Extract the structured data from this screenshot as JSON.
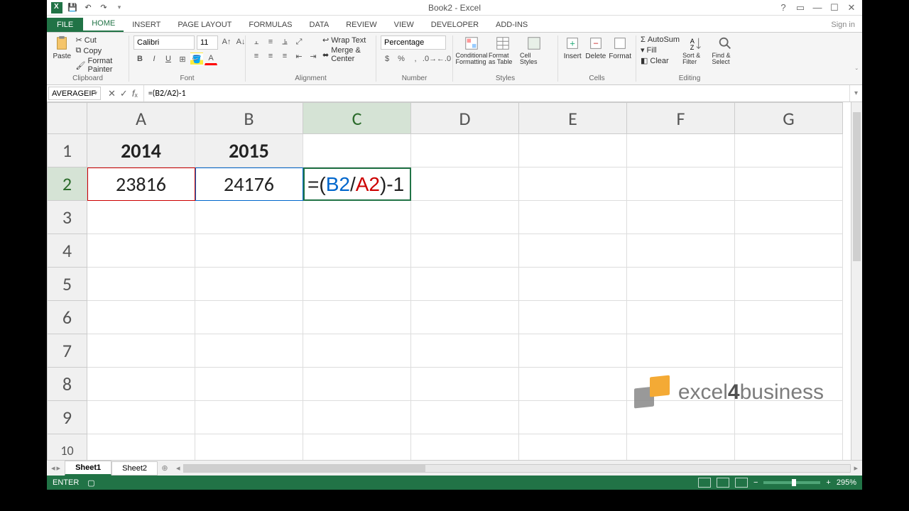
{
  "title": "Book2 - Excel",
  "tabs": {
    "file": "FILE",
    "list": [
      "HOME",
      "INSERT",
      "PAGE LAYOUT",
      "FORMULAS",
      "DATA",
      "REVIEW",
      "VIEW",
      "DEVELOPER",
      "ADD-INS"
    ],
    "active": "HOME",
    "signin": "Sign in"
  },
  "ribbon": {
    "clipboard": {
      "label": "Clipboard",
      "paste": "Paste",
      "cut": "Cut",
      "copy": "Copy",
      "painter": "Format Painter"
    },
    "font": {
      "label": "Font",
      "name": "Calibri",
      "size": "11"
    },
    "alignment": {
      "label": "Alignment",
      "wrap": "Wrap Text",
      "merge": "Merge & Center"
    },
    "number": {
      "label": "Number",
      "format": "Percentage"
    },
    "styles": {
      "label": "Styles",
      "cond": "Conditional Formatting",
      "fat": "Format as Table",
      "cell": "Cell Styles"
    },
    "cells": {
      "label": "Cells",
      "insert": "Insert",
      "delete": "Delete",
      "format": "Format"
    },
    "editing": {
      "label": "Editing",
      "autosum": "AutoSum",
      "fill": "Fill",
      "clear": "Clear",
      "sort": "Sort & Filter",
      "find": "Find & Select"
    }
  },
  "namebox": "AVERAGEIF",
  "formula_bar": "=(B2/A2)-1",
  "columns": [
    "A",
    "B",
    "C",
    "D",
    "E",
    "F",
    "G"
  ],
  "rows": [
    "1",
    "2",
    "3",
    "4",
    "5",
    "6",
    "7",
    "8",
    "9",
    "10"
  ],
  "active_col": "C",
  "active_row": "2",
  "cells": {
    "A1": "2014",
    "B1": "2015",
    "A2": "23816",
    "B2": "24176"
  },
  "editing_cell": {
    "eq": "=",
    "p1": "(",
    "refB": "B2",
    "slash": "/",
    "refA": "A2",
    "p2": ")",
    "tail": "-1"
  },
  "sheets": {
    "list": [
      "Sheet1",
      "Sheet2"
    ],
    "active": "Sheet1"
  },
  "status": {
    "mode": "ENTER",
    "zoom": "295%"
  },
  "watermark": {
    "brand_a": "excel",
    "brand_b": "4",
    "brand_c": "business"
  },
  "chart_data": {
    "type": "table",
    "title": "",
    "columns": [
      "2014",
      "2015"
    ],
    "rows": [
      [
        23816,
        24176
      ]
    ],
    "formula_C2": "=(B2/A2)-1"
  }
}
